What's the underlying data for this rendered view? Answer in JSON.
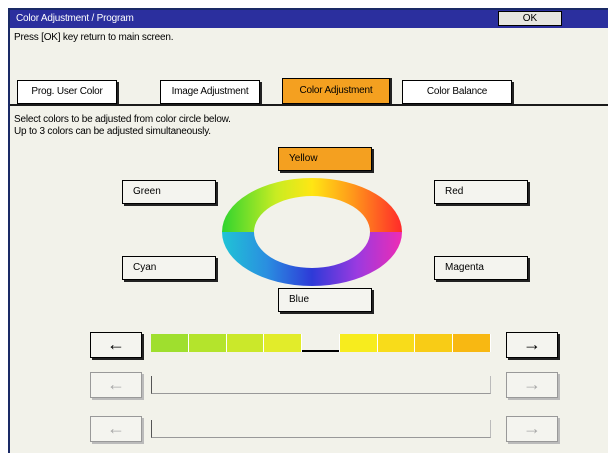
{
  "window": {
    "title": "Color Adjustment / Program",
    "ok_label": "OK"
  },
  "subtitle": "Press [OK] key return to main screen.",
  "tabs": [
    {
      "label": "Prog. User Color",
      "active": false
    },
    {
      "label": "Image Adjustment",
      "active": false
    },
    {
      "label": "Color Adjustment",
      "active": true
    },
    {
      "label": "Color Balance",
      "active": false
    }
  ],
  "instructions": [
    "Select colors to be adjusted from color circle below.",
    "Up to 3 colors can be adjusted simultaneously."
  ],
  "colors": {
    "yellow": {
      "label": "Yellow",
      "selected": true
    },
    "green": {
      "label": "Green",
      "selected": false
    },
    "red": {
      "label": "Red",
      "selected": false
    },
    "cyan": {
      "label": "Cyan",
      "selected": false
    },
    "magenta": {
      "label": "Magenta",
      "selected": false
    },
    "blue": {
      "label": "Blue",
      "selected": false
    }
  },
  "adjusters": [
    {
      "left_icon": "left-arrow-icon",
      "right_icon": "right-arrow-icon",
      "enabled": true,
      "segments": [
        "#9fdf2e",
        "#b4e42c",
        "#cbe82a",
        "#e2ec2a",
        "gap",
        "#f7ec1e",
        "#f8dc1a",
        "#f8cc16",
        "#f8b812"
      ]
    },
    {
      "left_icon": "left-arrow-icon",
      "right_icon": "right-arrow-icon",
      "enabled": false
    },
    {
      "left_icon": "left-arrow-icon",
      "right_icon": "right-arrow-icon",
      "enabled": false
    }
  ],
  "accent": {
    "title_bar": "#2b2f9e",
    "selected": "#f4a020"
  }
}
